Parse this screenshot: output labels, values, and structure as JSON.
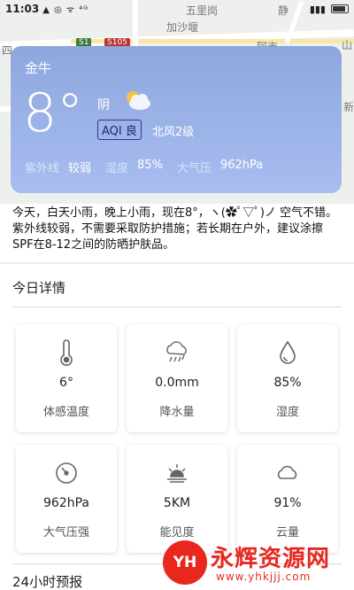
{
  "status_bar": {
    "time": "11:03",
    "icons_text": "▲ ◎ ᯤ ⁴ᴳ"
  },
  "map": {
    "labels": [
      "五里岗",
      "加沙堰",
      "静",
      "S105",
      "S1",
      "山",
      "阿吉",
      "四",
      "新"
    ]
  },
  "weather": {
    "city": "金牛",
    "temperature": "8°",
    "condition": "阴",
    "aqi": "AQI 良",
    "wind": "北风2级",
    "uv_label": "紫外线",
    "uv_value": "较弱",
    "humidity_label": "湿度",
    "humidity_value": "85%",
    "pressure_label": "大气压",
    "pressure_value": "962hPa"
  },
  "description": "今天，白天小雨，晚上小雨，现在8°，ヽ(✿ﾟ▽ﾟ)ノ 空气不错。紫外线较弱，不需要采取防护措施；若长期在户外，建议涂擦SPF在8-12之间的防晒护肤品。",
  "today": {
    "title": "今日详情",
    "tiles": [
      {
        "icon": "thermometer-icon",
        "value": "6°",
        "label": "体感温度"
      },
      {
        "icon": "rain-cloud-icon",
        "value": "0.0mm",
        "label": "降水量"
      },
      {
        "icon": "water-drop-icon",
        "value": "85%",
        "label": "湿度"
      },
      {
        "icon": "gauge-icon",
        "value": "962hPa",
        "label": "大气压强"
      },
      {
        "icon": "sunrise-icon",
        "value": "5KM",
        "label": "能见度"
      },
      {
        "icon": "cloud-icon",
        "value": "91%",
        "label": "云量"
      }
    ]
  },
  "next_section": {
    "title": "24小时预报"
  },
  "watermark": {
    "logo": "YH",
    "name": "永辉资源网",
    "url": "www.yhkjjj.com"
  },
  "colors": {
    "card_top": "#8da7dd",
    "card_bottom": "#a8bdf0",
    "aqi_border": "#3b2f9a",
    "watermark_red": "#e8281e"
  }
}
